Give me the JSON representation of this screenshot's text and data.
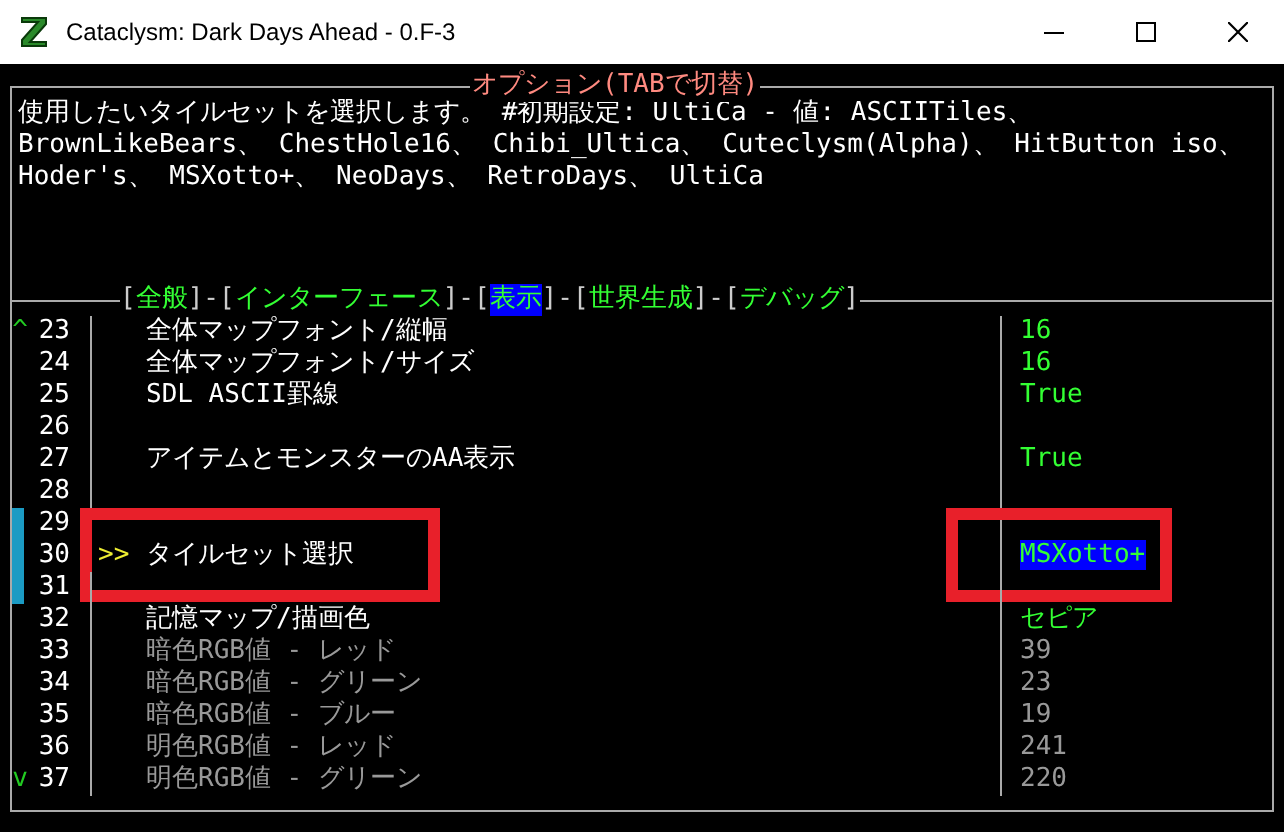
{
  "window": {
    "title": "Cataclysm: Dark Days Ahead - 0.F-3"
  },
  "panel": {
    "title": "オプション(TABで切替)",
    "description_lines": [
      "使用したいタイルセットを選択します。 #初期設定: UltiCa - 値: ASCIITiles、",
      "BrownLikeBears、 ChestHole16、 Chibi_Ultica、 Cuteclysm(Alpha)、 HitButton iso、",
      "Hoder's、 MSXotto+、 NeoDays、 RetroDays、 UltiCa"
    ]
  },
  "tabs": [
    {
      "open": "[",
      "label": "全般",
      "close": "]",
      "selected": false
    },
    {
      "separator": "-",
      "open": "[",
      "label": "インターフェース",
      "close": "]",
      "selected": false
    },
    {
      "separator": "-",
      "open": "[",
      "label": "表示",
      "close": "]",
      "selected": true
    },
    {
      "separator": "-",
      "open": "[",
      "label": "世界生成",
      "close": "]",
      "selected": false
    },
    {
      "separator": "-",
      "open": "[",
      "label": "デバッグ",
      "close": "]",
      "selected": false
    }
  ],
  "scroll": {
    "up": "^",
    "down": "v"
  },
  "cursor": ">>",
  "options": [
    {
      "number": "23",
      "label": "全体マップフォント/縦幅",
      "value": "16",
      "enabled": true,
      "selected": false,
      "outlined": false
    },
    {
      "number": "24",
      "label": "全体マップフォント/サイズ",
      "value": "16",
      "enabled": true,
      "selected": false,
      "outlined": false
    },
    {
      "number": "25",
      "label": "SDL ASCII罫線",
      "value": "True",
      "enabled": true,
      "selected": false,
      "outlined": false
    },
    {
      "number": "26",
      "selected": false,
      "outlined": false
    },
    {
      "number": "27",
      "label": "アイテムとモンスターのAA表示",
      "value": "True",
      "enabled": true,
      "selected": false,
      "outlined": false
    },
    {
      "number": "28",
      "selected": false,
      "outlined": false
    },
    {
      "number": "29",
      "selected": false,
      "outlined": false
    },
    {
      "number": "30",
      "label": "タイルセット選択",
      "value": "MSXotto+",
      "enabled": true,
      "selected": true,
      "outlined": true
    },
    {
      "number": "31",
      "selected": false,
      "outlined": false
    },
    {
      "number": "32",
      "label": "記憶マップ/描画色",
      "value": "セピア",
      "enabled": true,
      "selected": false,
      "outlined": false
    },
    {
      "number": "33",
      "label": "暗色RGB値 - レッド",
      "value": "39",
      "enabled": false,
      "selected": false,
      "outlined": false
    },
    {
      "number": "34",
      "label": "暗色RGB値 - グリーン",
      "value": "23",
      "enabled": false,
      "selected": false,
      "outlined": false
    },
    {
      "number": "35",
      "label": "暗色RGB値 - ブルー",
      "value": "19",
      "enabled": false,
      "selected": false,
      "outlined": false
    },
    {
      "number": "36",
      "label": "明色RGB値 - レッド",
      "value": "241",
      "enabled": false,
      "selected": false,
      "outlined": false
    },
    {
      "number": "37",
      "label": "明色RGB値 - グリーン",
      "value": "220",
      "enabled": false,
      "selected": false,
      "outlined": false
    }
  ]
}
